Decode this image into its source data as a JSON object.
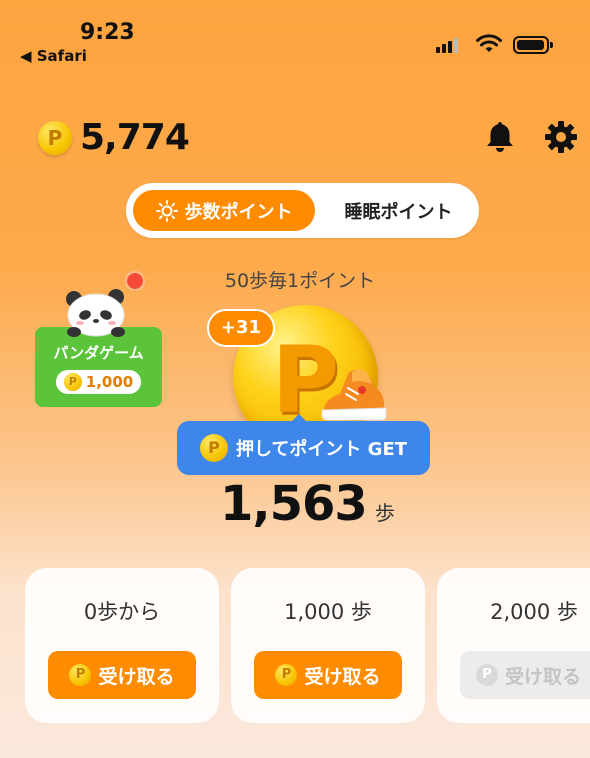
{
  "status_bar": {
    "time": "9:23",
    "back_app": "◀ Safari"
  },
  "balance": {
    "coin_symbol": "P",
    "value": "5,774"
  },
  "mode_switch": {
    "active": "歩数ポイント",
    "inactive": "睡眠ポイント"
  },
  "rate_text": "50歩毎1ポイント",
  "panda_game": {
    "label": "パンダゲーム",
    "points": "1,000"
  },
  "coin": {
    "symbol": "P",
    "bonus": "+31"
  },
  "get_button": {
    "label": "押してポイント GET"
  },
  "steps": {
    "value": "1,563",
    "unit": "歩"
  },
  "milestones": [
    {
      "title": "0歩から",
      "button": "受け取る",
      "enabled": true
    },
    {
      "title": "1,000 歩",
      "button": "受け取る",
      "enabled": true
    },
    {
      "title": "2,000 歩",
      "button": "受け取る",
      "enabled": false
    }
  ],
  "colors": {
    "accent": "#fe8b00",
    "get_button": "#3e86e9",
    "panda_badge": "#5bc43b",
    "notification": "#f44a3a"
  }
}
